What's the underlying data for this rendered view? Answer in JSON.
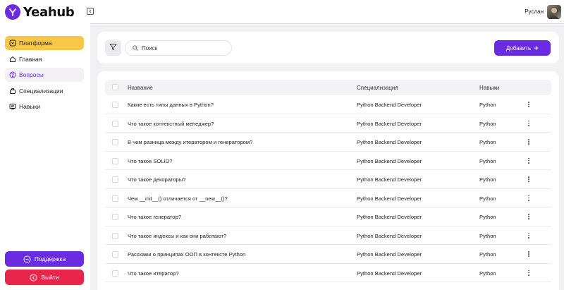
{
  "app": {
    "name": "Yeahub"
  },
  "sidebar": {
    "items": [
      {
        "label": "Платформа",
        "icon": "platform-icon"
      },
      {
        "label": "Главная",
        "icon": "home-icon"
      },
      {
        "label": "Вопросы",
        "icon": "question-icon"
      },
      {
        "label": "Специализации",
        "icon": "specialization-icon"
      },
      {
        "label": "Навыки",
        "icon": "skills-icon"
      }
    ],
    "support_label": "Поддержка",
    "logout_label": "Выйти"
  },
  "header": {
    "user_name": "Руслан"
  },
  "toolbar": {
    "search_placeholder": "Поиск",
    "add_label": "Добавить"
  },
  "table": {
    "columns": [
      "Название",
      "Специализация",
      "Навыки"
    ],
    "rows": [
      {
        "title": "Какие есть типы данных в Python?",
        "specialization": "Python Backend Developer",
        "skill": "Python"
      },
      {
        "title": "Что такое контекстный менеджер?",
        "specialization": "Python Backend Developer",
        "skill": "Python"
      },
      {
        "title": "В чем разница между итератором и генератором?",
        "specialization": "Python Backend Developer",
        "skill": "Python"
      },
      {
        "title": "Что такое SOLID?",
        "specialization": "Python Backend Developer",
        "skill": "Python"
      },
      {
        "title": "Что такое декораторы?",
        "specialization": "Python Backend Developer",
        "skill": "Python"
      },
      {
        "title": "Чем __init__() отличается от __new__()?",
        "specialization": "Python Backend Developer",
        "skill": "Python"
      },
      {
        "title": "Что такое генератор?",
        "specialization": "Python Backend Developer",
        "skill": "Python"
      },
      {
        "title": "Что такое индексы и как они работают?",
        "specialization": "Python Backend Developer",
        "skill": "Python"
      },
      {
        "title": "Расскажи о принципах ООП в контексте Python",
        "specialization": "Python Backend Developer",
        "skill": "Python"
      },
      {
        "title": "Что такое итератор?",
        "specialization": "Python Backend Developer",
        "skill": "Python"
      }
    ]
  },
  "colors": {
    "accent": "#6a2ce0",
    "platform_highlight": "#f8c749",
    "logout": "#e8254a"
  }
}
